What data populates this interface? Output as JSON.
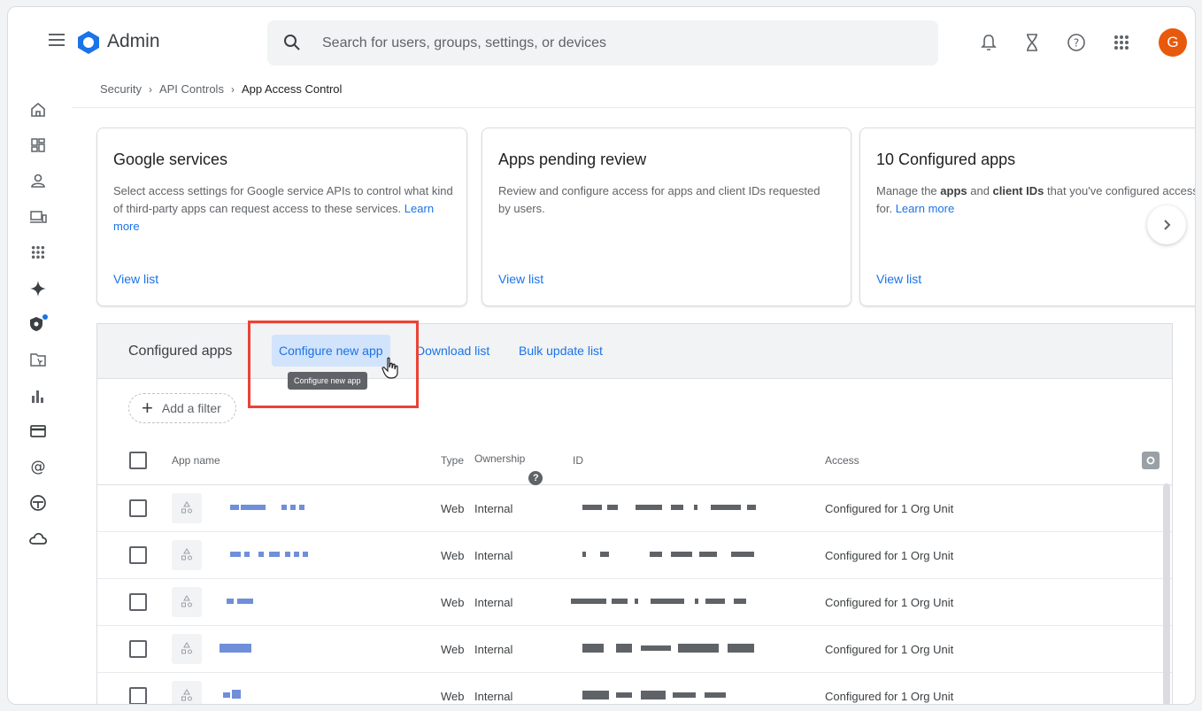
{
  "header": {
    "brand": "Admin",
    "search_placeholder": "Search for users, groups, settings, or devices",
    "avatar_letter": "G",
    "icons": [
      "hamburger-icon",
      "admin-logo-icon",
      "search-icon",
      "bell-icon",
      "hourglass-icon",
      "help-icon",
      "apps-grid-icon"
    ]
  },
  "rail_icons": [
    "home-icon",
    "dashboard-icon",
    "users-icon",
    "devices-icon",
    "apps-icon",
    "gemini-icon",
    "security-icon",
    "folder-icon",
    "reporting-icon",
    "billing-icon",
    "account-icon",
    "rules-icon",
    "storage-icon"
  ],
  "breadcrumb": {
    "items": [
      "Security",
      "API Controls",
      "App Access Control"
    ]
  },
  "cards": [
    {
      "title": "Google services",
      "desc": "Select access settings for Google service APIs to control what kind of third-party apps can request access to these services.",
      "learn_more": "Learn more",
      "view": "View list"
    },
    {
      "title": "Apps pending review",
      "desc": "Review and configure access for apps and client IDs requested by users.",
      "view": "View list"
    },
    {
      "title": "10 Configured apps",
      "desc_1": "Manage the ",
      "desc_bold_1": "apps",
      "desc_2": " and ",
      "desc_bold_2": "client IDs",
      "desc_3": " that you've configured access for.",
      "learn_more": "Learn more",
      "view": "View list"
    }
  ],
  "panel": {
    "title": "Configured apps",
    "configure_new": "Configure new app",
    "download": "Download list",
    "bulk_update": "Bulk update list",
    "tooltip": "Configure new app",
    "add_filter": "Add a filter"
  },
  "table": {
    "columns": {
      "app_name": "App name",
      "type": "Type",
      "ownership": "Ownership",
      "id": "ID",
      "access": "Access"
    },
    "rows": [
      {
        "type": "Web",
        "ownership": "Internal",
        "access": "Configured for 1 Org Unit"
      },
      {
        "type": "Web",
        "ownership": "Internal",
        "access": "Configured for 1 Org Unit"
      },
      {
        "type": "Web",
        "ownership": "Internal",
        "access": "Configured for 1 Org Unit"
      },
      {
        "type": "Web",
        "ownership": "Internal",
        "access": "Configured for 1 Org Unit"
      },
      {
        "type": "Web",
        "ownership": "Internal",
        "access": "Configured for 1 Org Unit"
      }
    ]
  },
  "colors": {
    "accent": "#1a73e8",
    "highlight": "#ea4335",
    "avatar": "#e8590c"
  }
}
